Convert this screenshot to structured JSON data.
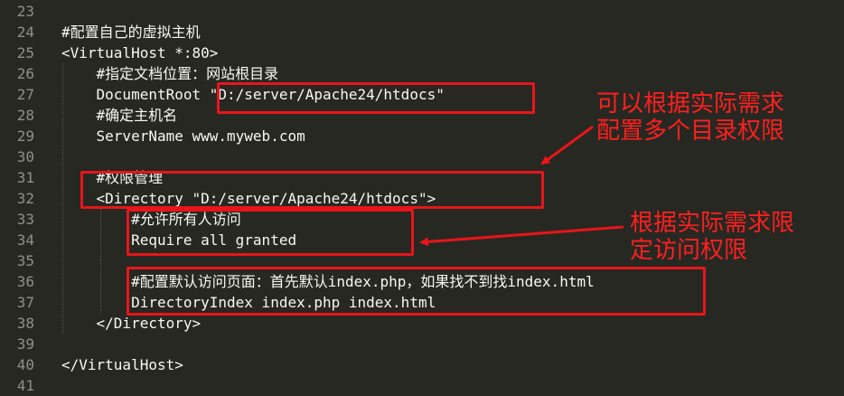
{
  "editor": {
    "lines": [
      {
        "number": "23",
        "text": ""
      },
      {
        "number": "24",
        "text": "#配置自己的虚拟主机"
      },
      {
        "number": "25",
        "text": "<VirtualHost *:80>"
      },
      {
        "number": "26",
        "text": "    #指定文档位置：网站根目录"
      },
      {
        "number": "27",
        "text": "    DocumentRoot \"D:/server/Apache24/htdocs\""
      },
      {
        "number": "28",
        "text": "    #确定主机名"
      },
      {
        "number": "29",
        "text": "    ServerName www.myweb.com"
      },
      {
        "number": "30",
        "text": ""
      },
      {
        "number": "31",
        "text": "    #权限管理"
      },
      {
        "number": "32",
        "text": "    <Directory \"D:/server/Apache24/htdocs\">"
      },
      {
        "number": "33",
        "text": "        #允许所有人访问"
      },
      {
        "number": "34",
        "text": "        Require all granted"
      },
      {
        "number": "35",
        "text": ""
      },
      {
        "number": "36",
        "text": "        #配置默认访问页面：首先默认index.php，如果找不到找index.html"
      },
      {
        "number": "37",
        "text": "        DirectoryIndex index.php index.html"
      },
      {
        "number": "38",
        "text": "    </Directory>"
      },
      {
        "number": "39",
        "text": ""
      },
      {
        "number": "40",
        "text": "</VirtualHost>"
      },
      {
        "number": "41",
        "text": ""
      }
    ]
  },
  "annotations": {
    "directory_note": "可以根据实际需求\n配置多个目录权限",
    "access_note": "根据实际需求限\n定访问权限"
  },
  "colors": {
    "background": "#272822",
    "text": "#f8f8f2",
    "line_number": "#8f908a",
    "highlight": "#e8151b"
  }
}
